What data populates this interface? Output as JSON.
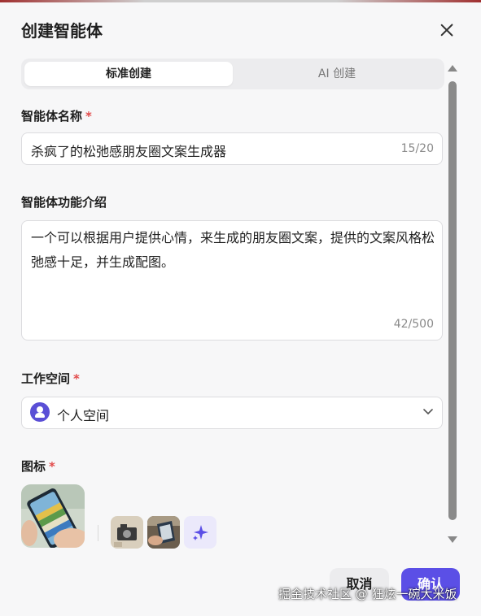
{
  "dialog": {
    "title": "创建智能体"
  },
  "tabs": [
    {
      "label": "标准创建",
      "active": true
    },
    {
      "label": "AI 创建",
      "active": false
    }
  ],
  "name_field": {
    "label": "智能体名称",
    "required_mark": "*",
    "value": "杀疯了的松弛感朋友圈文案生成器",
    "counter": "15/20"
  },
  "description_field": {
    "label": "智能体功能介绍",
    "value": "一个可以根据用户提供心情，来生成的朋友圈文案，提供的文案风格松弛感十足，并生成配图。",
    "counter": "42/500"
  },
  "workspace_field": {
    "label": "工作空间",
    "required_mark": "*",
    "selected": "个人空间",
    "icon": "person-icon"
  },
  "icon_field": {
    "label": "图标",
    "required_mark": "*",
    "generate_icon": "sparkle-icon"
  },
  "footer": {
    "cancel_label": "取消",
    "confirm_label": "确认"
  },
  "watermark": "掘金技术社区 @ 狂炫一碗大米饭",
  "colors": {
    "accent": "#5b4fe6",
    "required": "#e24b4b",
    "background": "#f7f7f8"
  }
}
